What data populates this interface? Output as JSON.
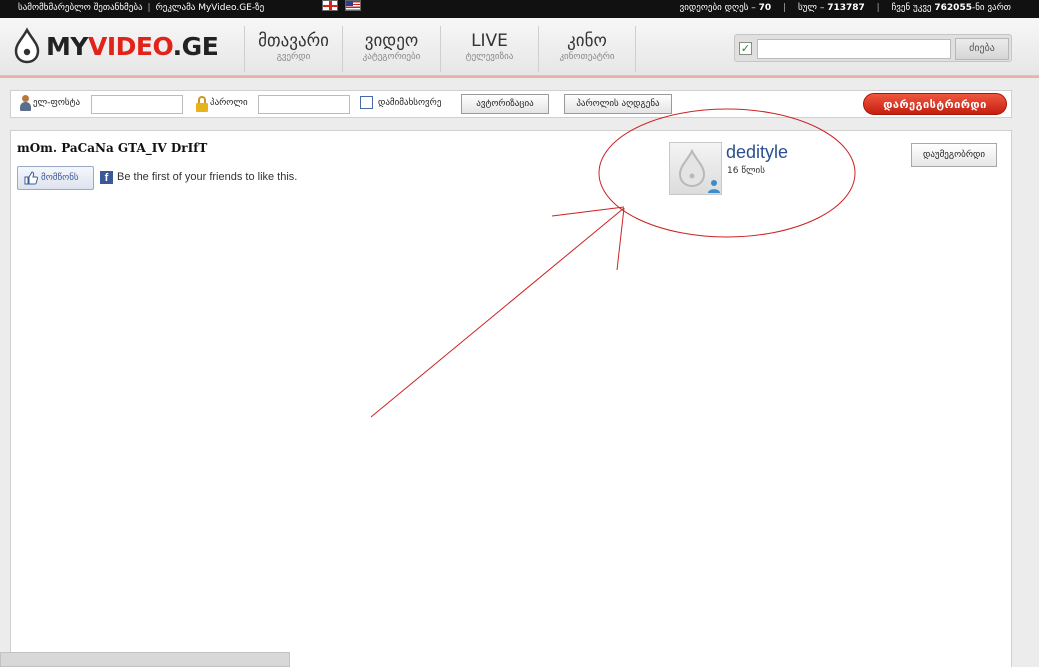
{
  "topbar": {
    "link_rules": "სამომხმარებლო შეთანხმება",
    "link_ads": "რეკლამა MyVideo.GE-ზე",
    "stat_today_label": "ვიდეოები დღეს –",
    "stat_today_value": "70",
    "stat_online_label": "სულ –",
    "stat_online_value": "713787",
    "stat_rank_label": "ჩვენ უკვე",
    "stat_rank_value": "762055",
    "stat_rank_suffix": "-ნი ვართ"
  },
  "logo": {
    "my": "MY",
    "video": "VIDEO",
    "ge": ".GE"
  },
  "nav": [
    {
      "title": "მთავარი",
      "sub": "გვერდი"
    },
    {
      "title": "ვიდეო",
      "sub": "კატეგორიები"
    },
    {
      "title": "LIVE",
      "sub": "ტელევიზია"
    },
    {
      "title": "კინო",
      "sub": "კინოთეატრი"
    }
  ],
  "search": {
    "value": "",
    "button": "ძიება",
    "checked": "✓"
  },
  "login": {
    "email_label": "ელ-ფოსტა",
    "password_label": "პაროლი",
    "remember_label": "დამიმახსოვრე",
    "login_button": "ავტორიზაცია",
    "recover_button": "პაროლის აღდგენა",
    "register_button": "დარეგისტრირდი"
  },
  "video": {
    "title": "mOm. PaCaNa GTA_IV DrIfT",
    "like_label": "მომწონს",
    "fb_icon": "f",
    "fb_text": "Be the first of your friends to like this."
  },
  "user": {
    "name": "dedityle",
    "age": "16 წლის",
    "subscribe_button": "დაუმეგობრდი"
  },
  "annotation_color": "#cc2222"
}
